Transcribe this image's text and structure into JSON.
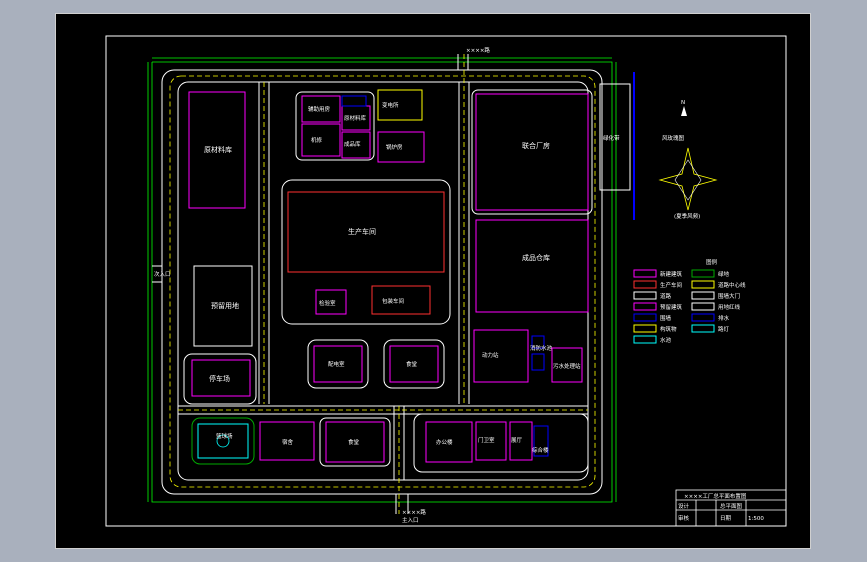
{
  "colors": {
    "background": "#000000",
    "sheet_border": "#ffffff",
    "road": "#ffffff",
    "centerline": "#ffff00",
    "dimension": "#00ff00",
    "building": "#ff00ff",
    "production": "#ff3030",
    "green": "#00aa00",
    "water": "#0000ff",
    "cyan": "#00ffff"
  },
  "roads": {
    "north_road": "××××路",
    "south_road": "××××路",
    "west_gate": "次入口",
    "south_gate": "主入口"
  },
  "buildings": {
    "top_small_1": "辅助用房",
    "top_small_2": "原材料库",
    "top_small_3": "机修",
    "top_small_4": "成品库",
    "top_center_1": "变电所",
    "top_center_2": "锅炉房",
    "warehouse_left": "原材料库",
    "production": "生产车间",
    "inspection": "检验室",
    "product_store": "包装车间",
    "plant_room": "配电室",
    "office_small_1": "食堂",
    "office_small_2": "浴室",
    "right_top": "联合厂房",
    "right_mid": "成品仓库",
    "right_bottom_1": "动力站",
    "right_bottom_2": "消防水池",
    "right_bottom_3": "污水处理站",
    "left_mid": "预留用地",
    "left_lower": "停车场",
    "court": "篮球场",
    "bottom_1": "宿舍",
    "bottom_2": "食堂",
    "bottom_3": "办公楼",
    "bottom_4": "门卫室",
    "bottom_5": "展厅",
    "bottom_6": "综合楼",
    "greenbelt": "绿化带"
  },
  "compass": {
    "north": "N",
    "title": "风玫瑰图",
    "caption": "(夏季风频)"
  },
  "legend": {
    "title": "图例",
    "items": [
      {
        "label": "新建建筑",
        "color": "#ff00ff"
      },
      {
        "label": "生产车间",
        "color": "#ff3030"
      },
      {
        "label": "道路",
        "color": "#ffffff"
      },
      {
        "label": "预留建筑",
        "color": "#ff00ff"
      },
      {
        "label": "围墙",
        "color": "#0000ff"
      },
      {
        "label": "构筑物",
        "color": "#ffff00"
      },
      {
        "label": "水池",
        "color": "#00ffff"
      }
    ],
    "items_right": [
      {
        "label": "绿地",
        "color": "#00aa00"
      },
      {
        "label": "道路中心线",
        "color": "#ffff00"
      },
      {
        "label": "围墙大门",
        "color": "#ffffff"
      },
      {
        "label": "用地红线",
        "color": "#ffffff"
      },
      {
        "label": "排水",
        "color": "#0000ff"
      },
      {
        "label": "路灯",
        "color": "#00ffff"
      }
    ]
  },
  "title_block": {
    "project": "××××工厂总平面布置图",
    "drawing": "总平面图",
    "scale": "1:500",
    "designer": "设计",
    "checker": "审核",
    "date": "日期"
  }
}
